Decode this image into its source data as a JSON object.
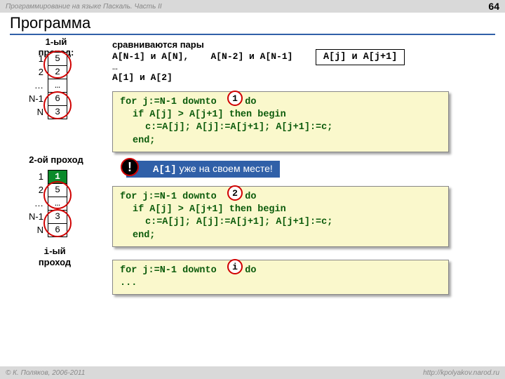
{
  "header": {
    "breadcrumb": "Программирование на языке Паскаль. Часть II",
    "page": "64"
  },
  "title": "Программа",
  "pass1": {
    "label": "1-ый проход:",
    "indices": [
      "1",
      "2",
      "…",
      "N-1",
      "N"
    ],
    "cells": [
      "5",
      "2",
      "…",
      "6",
      "3"
    ]
  },
  "pass2": {
    "label": "2-ой проход",
    "indices": [
      "1",
      "2",
      "…",
      "N-1",
      "N"
    ],
    "cells": [
      "1",
      "5",
      "…",
      "3",
      "6"
    ]
  },
  "ith_label": "i-ый проход",
  "pairs_heading": "сравниваются пары",
  "pairs_line1a": "A[N-1] и A[N],",
  "pairs_line1b": "A[N-2] и A[N-1]",
  "pairs_line2": "…",
  "pairs_line3": "A[1] и A[2]",
  "aj_box": "A[j] и A[j+1]",
  "code1": {
    "l1a": "for j:=N-1 downto ",
    "step": "1",
    "l1b": " do",
    "l2": "if A[j] > A[j+1] then begin",
    "l3": "c:=A[j]; A[j]:=A[j+1]; A[j+1]:=c;",
    "l4": "end;"
  },
  "code2": {
    "l1a": "for j:=N-1 downto ",
    "step": "2",
    "l1b": " do",
    "l2": "if A[j] > A[j+1] then begin",
    "l3": "c:=A[j]; A[j]:=A[j+1]; A[j+1]:=c;",
    "l4": "end;"
  },
  "code3": {
    "l1a": "for j:=N-1 downto ",
    "step": "i",
    "l1b": " do",
    "l2": "..."
  },
  "badge": {
    "mono": "A[1]",
    "rest": " уже на своем месте!"
  },
  "footer": {
    "author": "© К. Поляков, 2006-2011",
    "url": "http://kpolyakov.narod.ru"
  }
}
